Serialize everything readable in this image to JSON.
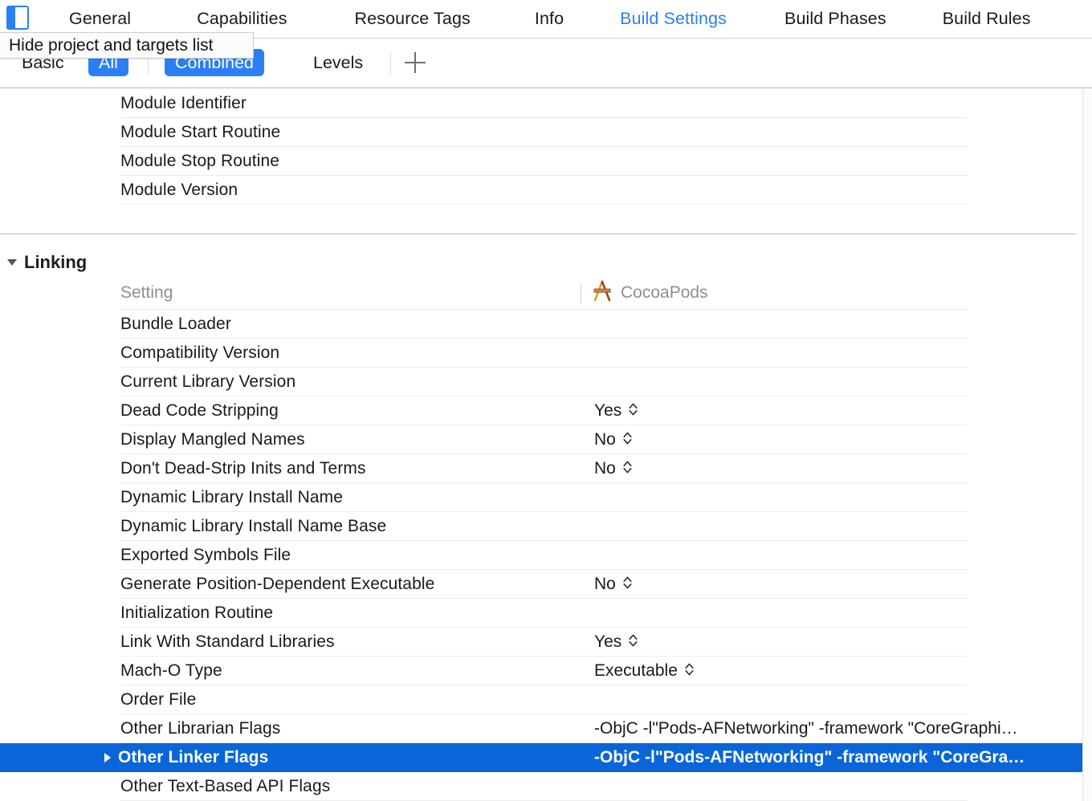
{
  "window": {
    "panel_toggle_icon": "show-hide-navigator-icon"
  },
  "tabs": [
    {
      "label": "General",
      "active": false
    },
    {
      "label": "Capabilities",
      "active": false
    },
    {
      "label": "Resource Tags",
      "active": false
    },
    {
      "label": "Info",
      "active": false
    },
    {
      "label": "Build Settings",
      "active": true
    },
    {
      "label": "Build Phases",
      "active": false
    },
    {
      "label": "Build Rules",
      "active": false
    }
  ],
  "tooltip": {
    "text": "Hide project and targets list"
  },
  "filterbar": {
    "basic_label": "Basic",
    "all_label": "All",
    "combined_label": "Combined",
    "levels_label": "Levels",
    "add_label": "+",
    "add_icon": "plus-icon",
    "selected_scope": "All",
    "selected_view": "Combined"
  },
  "search": {
    "value": "",
    "placeholder": "",
    "icon": "search-icon",
    "dropdown_icon": "chevron-down-icon"
  },
  "top_rows": [
    {
      "name": "Module Identifier",
      "value": ""
    },
    {
      "name": "Module Start Routine",
      "value": ""
    },
    {
      "name": "Module Stop Routine",
      "value": ""
    },
    {
      "name": "Module Version",
      "value": ""
    }
  ],
  "linking_group": {
    "title": "Linking",
    "expanded": true,
    "disclosure_icon": "triangle-down-icon",
    "columns": {
      "setting_header": "Setting",
      "target_header": "CocoaPods",
      "target_icon": "cocoapods-icon"
    },
    "rows": [
      {
        "name": "Bundle Loader",
        "value": "",
        "type": "text",
        "selected": false
      },
      {
        "name": "Compatibility Version",
        "value": "",
        "type": "text",
        "selected": false
      },
      {
        "name": "Current Library Version",
        "value": "",
        "type": "text",
        "selected": false
      },
      {
        "name": "Dead Code Stripping",
        "value": "Yes",
        "type": "popup",
        "selected": false
      },
      {
        "name": "Display Mangled Names",
        "value": "No",
        "type": "popup",
        "selected": false
      },
      {
        "name": "Don't Dead-Strip Inits and Terms",
        "value": "No",
        "type": "popup",
        "selected": false
      },
      {
        "name": "Dynamic Library Install Name",
        "value": "",
        "type": "text",
        "selected": false
      },
      {
        "name": "Dynamic Library Install Name Base",
        "value": "",
        "type": "text",
        "selected": false
      },
      {
        "name": "Exported Symbols File",
        "value": "",
        "type": "text",
        "selected": false
      },
      {
        "name": "Generate Position-Dependent Executable",
        "value": "No",
        "type": "popup",
        "selected": false
      },
      {
        "name": "Initialization Routine",
        "value": "",
        "type": "text",
        "selected": false
      },
      {
        "name": "Link With Standard Libraries",
        "value": "Yes",
        "type": "popup",
        "selected": false
      },
      {
        "name": "Mach-O Type",
        "value": "Executable",
        "type": "popup",
        "selected": false
      },
      {
        "name": "Order File",
        "value": "",
        "type": "text",
        "selected": false
      },
      {
        "name": "Other Librarian Flags",
        "value": "-ObjC -l\"Pods-AFNetworking\" -framework \"CoreGraphi…",
        "type": "long",
        "selected": false
      },
      {
        "name": "Other Linker Flags",
        "value": "-ObjC -l\"Pods-AFNetworking\" -framework \"CoreGra…",
        "type": "long",
        "selected": true,
        "expandable": true
      },
      {
        "name": "Other Text-Based API Flags",
        "value": "",
        "type": "text",
        "selected": false
      }
    ]
  },
  "stepper_glyph": "⌃⌄",
  "colors": {
    "accent": "#2b7ff5",
    "selection": "#0a66d8",
    "row_separator": "#ececec",
    "muted_text": "#8e8e8e"
  }
}
